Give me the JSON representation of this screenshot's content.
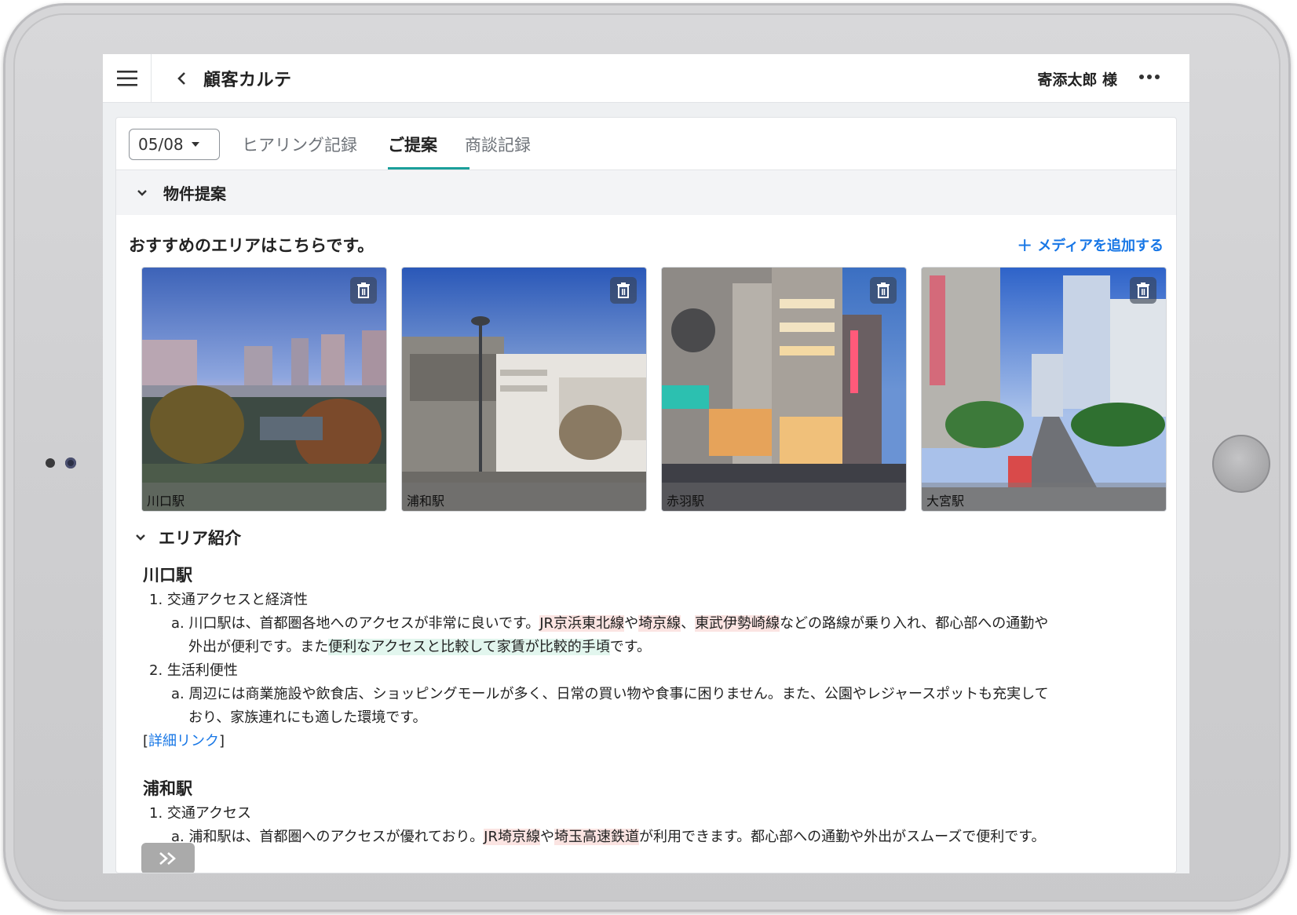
{
  "header": {
    "title": "顧客カルテ",
    "user_name": "寄添太郎 様"
  },
  "tabs": {
    "date_value": "05/08",
    "items": [
      "ヒアリング記録",
      "ご提案",
      "商談記録"
    ],
    "active": "ご提案"
  },
  "section": {
    "title": "物件提案",
    "recommend_text": "おすすめのエリアはこちらです。",
    "add_media_label": "メディアを追加する"
  },
  "photos": [
    {
      "caption": "川口駅"
    },
    {
      "caption": "浦和駅"
    },
    {
      "caption": "赤羽駅"
    },
    {
      "caption": "大宮駅"
    }
  ],
  "area": {
    "title": "エリア紹介",
    "kawaguchi": {
      "name": "川口駅",
      "item1": "1. 交通アクセスと経済性",
      "item1a_pre": "a. 川口駅は、首都圏各地へのアクセスが非常に良いです。",
      "item1a_hl1": "JR京浜東北線",
      "item1a_mid1": "や",
      "item1a_hl2": "埼京線",
      "item1a_mid2": "、",
      "item1a_hl3": "東武伊勢崎線",
      "item1a_post": "などの路線が乗り入れ、都心部への通勤や",
      "item1a_line2_pre": "外出が便利です。また",
      "item1a_line2_hl": "便利なアクセスと比較して家賃が比較的手頃",
      "item1a_line2_post": "です。",
      "item2": "2. 生活利便性",
      "item2a_line1": "a. 周辺には商業施設や飲食店、ショッピングモールが多く、日常の買い物や食事に困りません。また、公園やレジャースポットも充実して",
      "item2a_line2": "おり、家族連れにも適した環境です。",
      "link_open": "[",
      "link_text": "詳細リンク",
      "link_close": "]"
    },
    "urawa": {
      "name": "浦和駅",
      "item1": "1. 交通アクセス",
      "item1a_pre": "a. 浦和駅は、首都圏へのアクセスが優れており。",
      "item1a_hl1": "JR埼京線",
      "item1a_mid": "や",
      "item1a_hl2": "埼玉高速鉄道",
      "item1a_post": "が利用できます。都心部への通勤や外出がスムーズで便利です。"
    }
  },
  "colors": {
    "accent": "#1a9f9a",
    "link": "#1877e6",
    "highlight_red": "#fbe4e2",
    "highlight_green": "#e2f6ee"
  },
  "icons": [
    "menu-icon",
    "back-chevron-icon",
    "more-icon",
    "chevron-down-icon",
    "trash-icon",
    "plus-icon",
    "double-chevron-right-icon"
  ]
}
